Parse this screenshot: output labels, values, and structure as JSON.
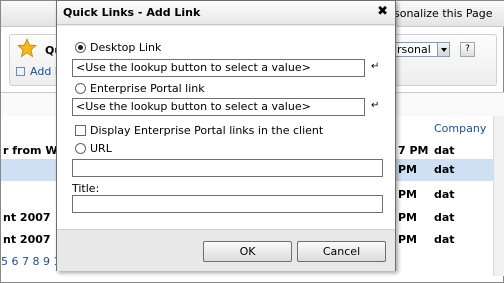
{
  "background": {
    "topbar_right_text": "sonalize this Page",
    "quick_links_fragment": "Qu",
    "add_link_fragment": "Add L",
    "view_select_value": "rsonal",
    "help_label": "?",
    "column_company": "Company",
    "rows": [
      {
        "c1": "r from Web",
        "c2": "7 PM",
        "c3": "dat",
        "selected": false
      },
      {
        "c1": "",
        "c2": "PM",
        "c3": "dat",
        "selected": true
      },
      {
        "c1": "",
        "c2": "PM",
        "c3": "dat",
        "selected": false
      },
      {
        "c1": "nt 2007",
        "c2": "PM",
        "c3": "dat",
        "selected": false
      },
      {
        "c1": "nt 2007",
        "c2": "PM",
        "c3": "dat",
        "selected": false
      }
    ],
    "pager_text": "5 6 7 8 9 10 ..."
  },
  "dialog": {
    "title": "Quick Links - Add Link",
    "close_glyph": "✖",
    "desktop_link_label": "Desktop Link",
    "desktop_lookup_value": "<Use the lookup button to select a value>",
    "portal_link_label": "Enterprise Portal link",
    "portal_lookup_value": "<Use the lookup button to select a value>",
    "lookup_glyph": "↵",
    "display_portal_label": "Display Enterprise Portal links in the client",
    "url_label": "URL",
    "url_value": "",
    "title_label": "Title:",
    "title_value": "",
    "ok_label": "OK",
    "cancel_label": "Cancel"
  },
  "colors": {
    "link_blue": "#1a4f9c",
    "selected_row": "#cfe0f5",
    "star": "#f3b81a"
  }
}
